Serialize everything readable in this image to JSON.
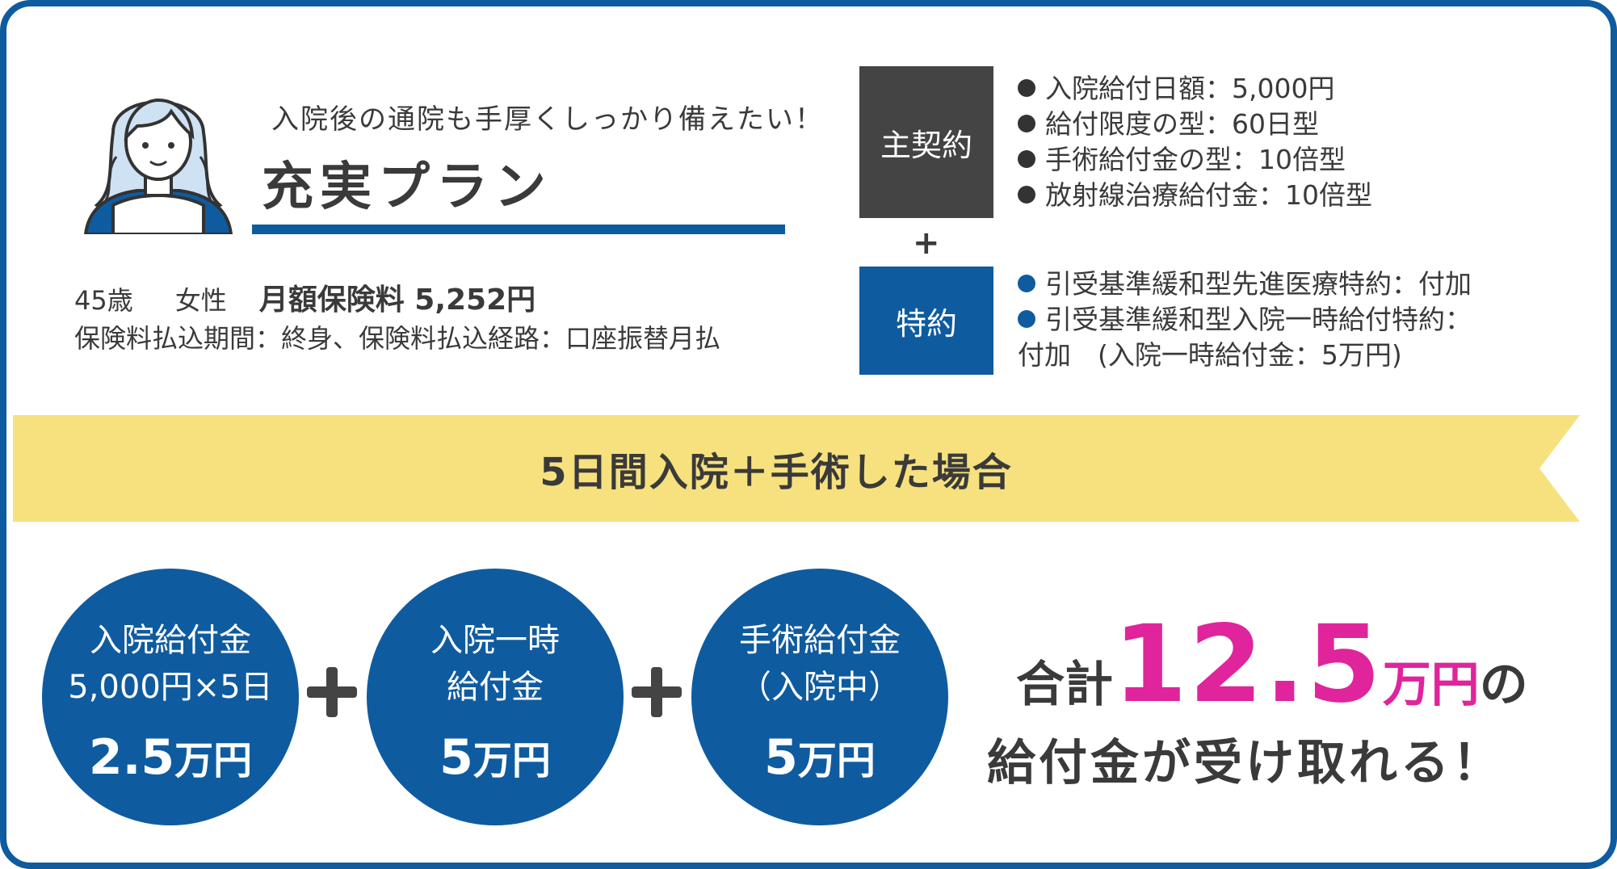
{
  "plan": {
    "headline": "入院後の通院も手厚くしっかり備えたい！",
    "title": "充実プラン"
  },
  "profile": {
    "age": "45歳",
    "gender": "女性",
    "premium": "月額保険料 5,252円",
    "payment": "保険料払込期間：終身、保険料払込経路：口座振替月払"
  },
  "contract": {
    "main_label": "主契約",
    "plus": "+",
    "rider_label": "特約",
    "main_items": [
      "入院給付日額：5,000円",
      "給付限度の型：60日型",
      "手術給付金の型：10倍型",
      "放射線治療給付金：10倍型"
    ],
    "rider_items": [
      "引受基準緩和型先進医療特約：付加",
      "引受基準緩和型入院一時給付特約："
    ],
    "rider_continuation": "付加　(入院一時給付金：5万円)"
  },
  "scenario": {
    "title": "5日間入院＋手術した場合"
  },
  "benefits": [
    {
      "line1": "入院給付金",
      "line2": "5,000円×5日",
      "amount": "2.5",
      "unit": "万円"
    },
    {
      "line1": "入院一時",
      "line2": "給付金",
      "amount": "5",
      "unit": "万円"
    },
    {
      "line1": "手術給付金",
      "line2": "（入院中）",
      "amount": "5",
      "unit": "万円"
    }
  ],
  "total": {
    "prefix": "合計",
    "number": "12.5",
    "unit": "万円",
    "suffix": "の",
    "line2": "給付金が受け取れる！"
  },
  "colors": {
    "brand_blue": "#0f5ba0",
    "dark_box": "#444444",
    "ribbon_yellow": "#f6e17e",
    "accent_pink": "#e0249c"
  },
  "icons": {
    "avatar": "woman-avatar-icon",
    "bullet": "filled-circle-bullet-icon",
    "plus": "plus-icon"
  }
}
